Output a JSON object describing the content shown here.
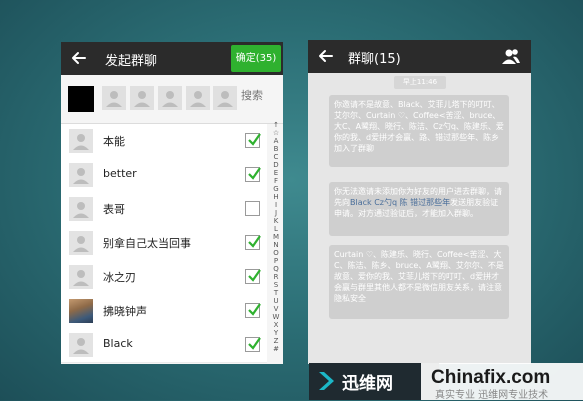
{
  "left_screen": {
    "title": "发起群聊",
    "confirm_label": "确定(35)",
    "search_placeholder": "搜索",
    "contacts": [
      {
        "name": "本能",
        "checked": true
      },
      {
        "name": "better",
        "checked": true
      },
      {
        "name": "表哥",
        "checked": false
      },
      {
        "name": "别拿自己太当回事",
        "checked": true
      },
      {
        "name": "冰之刃",
        "checked": true
      },
      {
        "name": "拂晓钟声",
        "checked": true,
        "avatar": "photo"
      },
      {
        "name": "Black",
        "checked": true
      }
    ],
    "index_letters": [
      "↑",
      "☆",
      "A",
      "B",
      "C",
      "D",
      "E",
      "F",
      "G",
      "H",
      "I",
      "J",
      "K",
      "L",
      "M",
      "N",
      "O",
      "P",
      "Q",
      "R",
      "S",
      "T",
      "U",
      "V",
      "W",
      "X",
      "Y",
      "Z",
      "#"
    ]
  },
  "right_screen": {
    "title": "群聊(15)",
    "timestamp": "早上11:46",
    "messages": [
      {
        "text": "你邀请不是故意、Black、艾菲儿塔下的叮叮、艾尔尔、Curtain ♡、Coffee<苦涩、bruce、大C、A鹭翔、晓行、陈洁、Cz勺q、陈建乐、爱你的我、d爱拼才会赢、路、错过那些年、陈乡加入了群聊"
      },
      {
        "pre": "你无法邀请未添加你为好友的用户进去群聊，请先向",
        "link": "Black Cz勺q 陈 错过那些年",
        "post": "发送朋友验证申请。对方通过验证后，才能加入群聊。"
      },
      {
        "text": "Curtain ♡、陈建乐、晓行、Coffee<苦涩、大C、陈洁、陈乡、bruce、A鹭翔、艾尔尔、不是故意、爱你的我、艾菲儿塔下的叮叮、d爱拼才会赢与群里其他人都不是微信朋友关系，请注意隐私安全"
      }
    ]
  },
  "watermark": {
    "name": "迅维网",
    "domain": "Chinafix.com",
    "sub": "真实专业  迅维网专业技术"
  },
  "colors": {
    "accent_green": "#2fb12f",
    "topbar": "#2b2b2b",
    "link": "#4a6e9a"
  }
}
